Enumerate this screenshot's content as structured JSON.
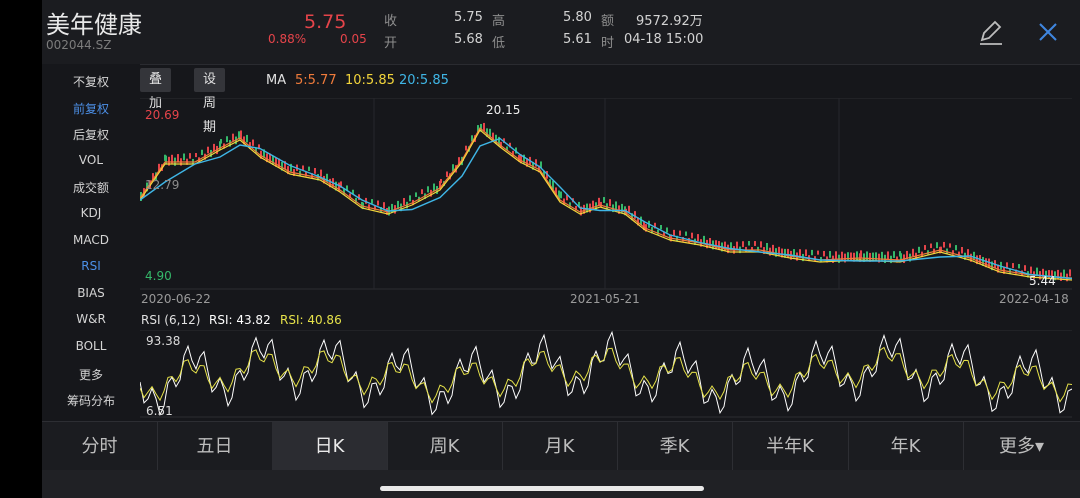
{
  "stock": {
    "name": "美年健康",
    "code": "002044.SZ",
    "price": "5.75",
    "change_pct": "0.88%",
    "change": "0.05"
  },
  "quote": {
    "close_label": "收",
    "close": "5.75",
    "high_label": "高",
    "high": "5.80",
    "amount_label": "额",
    "amount": "9572.92万",
    "open_label": "开",
    "open": "5.68",
    "low_label": "低",
    "low": "5.61",
    "time_label": "时",
    "time": "04-18 15:00"
  },
  "sidebar": {
    "items": [
      {
        "label": "不复权",
        "active": false
      },
      {
        "label": "前复权",
        "active": true
      },
      {
        "label": "后复权",
        "active": false
      },
      {
        "label": "VOL",
        "active": false
      },
      {
        "label": "成交额",
        "active": false
      },
      {
        "label": "KDJ",
        "active": false
      },
      {
        "label": "MACD",
        "active": false
      },
      {
        "label": "RSI",
        "active": true
      },
      {
        "label": "BIAS",
        "active": false
      },
      {
        "label": "W&R",
        "active": false
      },
      {
        "label": "BOLL",
        "active": false
      },
      {
        "label": "更多",
        "active": false
      },
      {
        "label": "筹码分布",
        "active": false
      }
    ]
  },
  "toolbar": {
    "overlay_label": "叠加",
    "period_label": "设周期",
    "ma_label": "MA",
    "ma5": "5:5.77",
    "ma10": "10:5.85",
    "ma20": "20:5.85"
  },
  "chart": {
    "high_label": "20.69",
    "mid_label": "12.79",
    "low_label": "4.90",
    "peak_label": "20.15",
    "last_label": "5.44",
    "date_start": "2020-06-22",
    "date_mid": "2021-05-21",
    "date_end": "2022-04-18",
    "colors": {
      "ma5": "#ef7b3b",
      "ma10": "#f3d53b",
      "ma20": "#3fb6e6",
      "up": "#e5444a",
      "down": "#35b86a"
    }
  },
  "rsi": {
    "title": "RSI (6,12)",
    "rsi6": "RSI: 43.82",
    "rsi12": "RSI: 40.86",
    "max_label": "93.38",
    "min_label": "6.51",
    "colors": {
      "rsi6": "#ffffff",
      "rsi12": "#e6e24a"
    }
  },
  "tabs": [
    {
      "label": "分时",
      "active": false
    },
    {
      "label": "五日",
      "active": false
    },
    {
      "label": "日K",
      "active": true
    },
    {
      "label": "周K",
      "active": false
    },
    {
      "label": "月K",
      "active": false
    },
    {
      "label": "季K",
      "active": false
    },
    {
      "label": "半年K",
      "active": false
    },
    {
      "label": "年K",
      "active": false
    },
    {
      "label": "更多▾",
      "active": false
    }
  ]
}
